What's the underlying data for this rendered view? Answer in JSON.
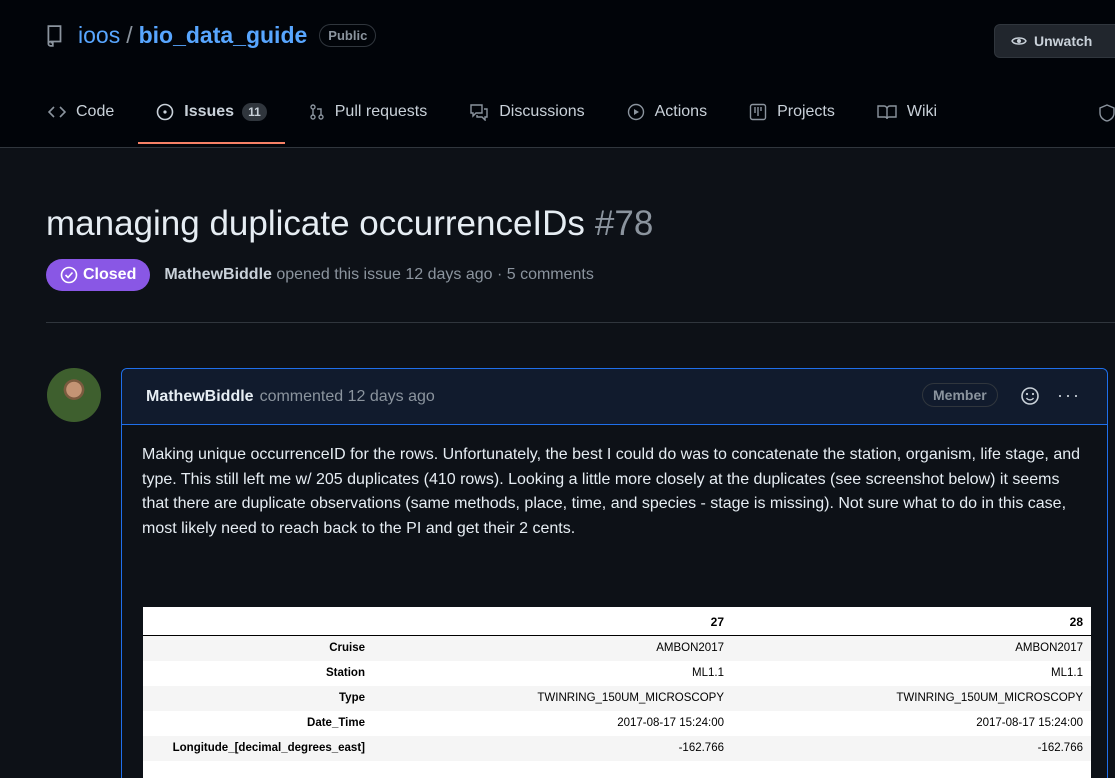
{
  "repo": {
    "owner": "ioos",
    "separator": "/",
    "name": "bio_data_guide",
    "visibility": "Public"
  },
  "watch_button": {
    "label": "Unwatch"
  },
  "tabs": [
    {
      "label": "Code",
      "icon": "code-icon"
    },
    {
      "label": "Issues",
      "icon": "issue-opened-icon",
      "count": "11"
    },
    {
      "label": "Pull requests",
      "icon": "git-pull-request-icon"
    },
    {
      "label": "Discussions",
      "icon": "discussion-icon"
    },
    {
      "label": "Actions",
      "icon": "play-icon"
    },
    {
      "label": "Projects",
      "icon": "table-icon"
    },
    {
      "label": "Wiki",
      "icon": "book-icon"
    }
  ],
  "issue": {
    "title": "managing duplicate occurrenceIDs",
    "number": "#78",
    "state": "Closed",
    "author": "MathewBiddle",
    "opened_text": "opened this issue 12 days ago · 5 comments"
  },
  "comment": {
    "author": "MathewBiddle",
    "time_text": "commented 12 days ago",
    "role": "Member",
    "body": "Making unique occurrenceID for the rows. Unfortunately, the best I could do was to concatenate the station, organism, life stage, and type. This still left me w/ 205 duplicates (410 rows). Looking a little more closely at the duplicates (see screenshot below) it seems that there are duplicate observations (same methods, place, time, and species - stage is missing). Not sure what to do in this case, most likely need to reach back to the PI and get their 2 cents."
  },
  "screenshot_table": {
    "columns": [
      "",
      "27",
      "28"
    ],
    "rows": [
      [
        "Cruise",
        "AMBON2017",
        "AMBON2017"
      ],
      [
        "Station",
        "ML1.1",
        "ML1.1"
      ],
      [
        "Type",
        "TWINRING_150UM_MICROSCOPY",
        "TWINRING_150UM_MICROSCOPY"
      ],
      [
        "Date_Time",
        "2017-08-17 15:24:00",
        "2017-08-17 15:24:00"
      ],
      [
        "Longitude_[decimal_degrees_east]",
        "-162.766",
        "-162.766"
      ]
    ]
  },
  "colors": {
    "accent": "#58a6ff",
    "closed": "#8957e5",
    "active_tab": "#f78166",
    "background": "#0d1117"
  }
}
